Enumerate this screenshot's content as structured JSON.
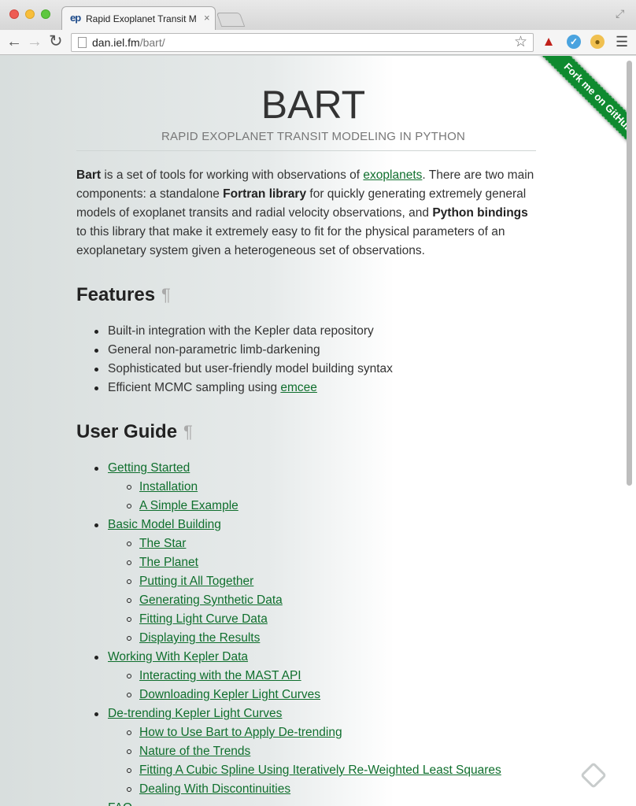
{
  "browser": {
    "tab_title": "Rapid Exoplanet Transit M",
    "favicon_text": "ep",
    "url_host": "dan.iel.fm",
    "url_path": "/bart/"
  },
  "page": {
    "ribbon": "Fork me on GitHub",
    "title": "BART",
    "subtitle": "RAPID EXOPLANET TRANSIT MODELING IN PYTHON",
    "intro": {
      "p1_bold": "Bart",
      "p1_text": " is a set of tools for working with observations of ",
      "p1_link": "exoplanets",
      "p2_text": ". There are two main components: a standalone ",
      "p2_bold": "Fortran library",
      "p3_text": " for quickly generating extremely general models of exoplanet transits and radial velocity observations, and ",
      "p3_bold": "Python bindings",
      "p4_text": " to this library that make it extremely easy to fit for the physical parameters of an exoplanetary system given a heterogeneous set of observations."
    },
    "features_heading": "Features",
    "features": [
      {
        "text": "Built-in integration with the Kepler data repository"
      },
      {
        "text": "General non-parametric limb-darkening"
      },
      {
        "text": "Sophisticated but user-friendly model building syntax"
      },
      {
        "text": "Efficient MCMC sampling using ",
        "link": "emcee"
      }
    ],
    "guide_heading": "User Guide",
    "guide": [
      {
        "level": 1,
        "text": "Getting Started"
      },
      {
        "level": 2,
        "text": "Installation"
      },
      {
        "level": 2,
        "text": "A Simple Example"
      },
      {
        "level": 1,
        "text": "Basic Model Building"
      },
      {
        "level": 2,
        "text": "The Star"
      },
      {
        "level": 2,
        "text": "The Planet"
      },
      {
        "level": 2,
        "text": "Putting it All Together"
      },
      {
        "level": 2,
        "text": "Generating Synthetic Data"
      },
      {
        "level": 2,
        "text": "Fitting Light Curve Data"
      },
      {
        "level": 2,
        "text": "Displaying the Results"
      },
      {
        "level": 1,
        "text": "Working With Kepler Data"
      },
      {
        "level": 2,
        "text": "Interacting with the MAST API"
      },
      {
        "level": 2,
        "text": "Downloading Kepler Light Curves"
      },
      {
        "level": 1,
        "text": "De-trending Kepler Light Curves"
      },
      {
        "level": 2,
        "text": "How to Use Bart to Apply De-trending"
      },
      {
        "level": 2,
        "text": "Nature of the Trends"
      },
      {
        "level": 2,
        "text": "Fitting A Cubic Spline Using Iteratively Re-Weighted Least Squares"
      },
      {
        "level": 2,
        "text": "Dealing With Discontinuities"
      },
      {
        "level": 1,
        "text": "FAQ"
      }
    ],
    "pilcrow": "¶"
  },
  "icons": {
    "back": "back-arrow-icon",
    "forward": "forward-arrow-icon",
    "reload": "reload-icon",
    "star": "bookmark-star-icon",
    "menu": "hamburger-menu-icon",
    "feedly": "feedly-icon"
  },
  "colors": {
    "link": "#0f6f2d",
    "ribbon": "#0f8a2f",
    "text": "#333333"
  }
}
